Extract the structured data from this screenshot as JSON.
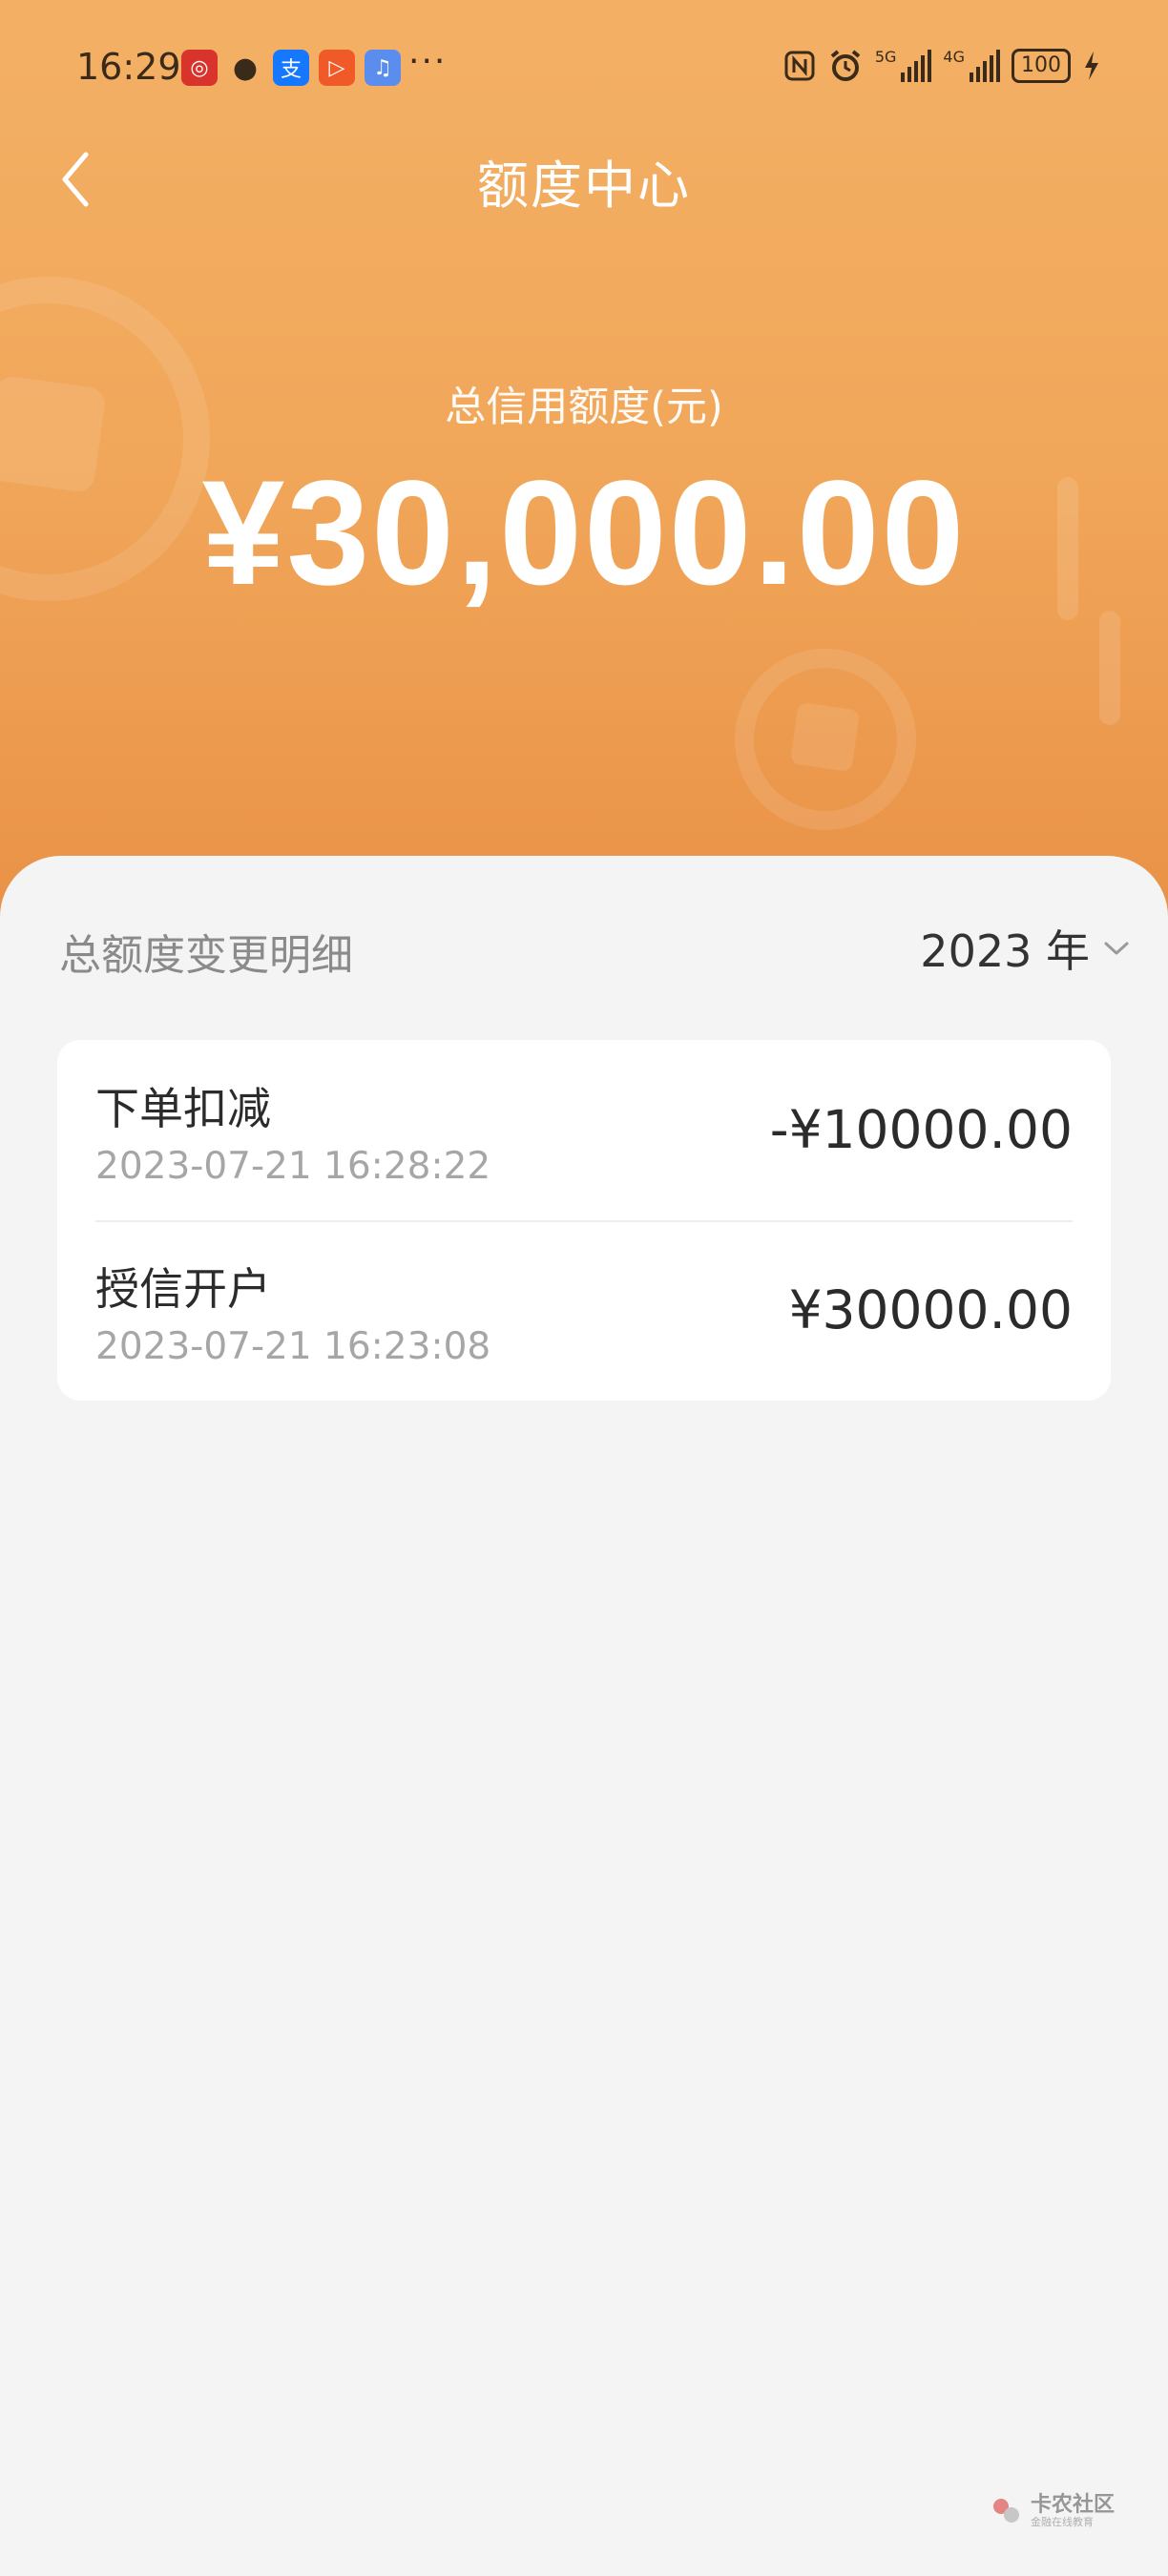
{
  "status_bar": {
    "time": "16:29",
    "apps": [
      {
        "icon": "bank-app-icon",
        "color": "#d9342b",
        "glyph": "◎"
      },
      {
        "icon": "wechat-icon",
        "color": "#3a2a1a",
        "glyph": "●"
      },
      {
        "icon": "alipay-icon",
        "color": "#1677ff",
        "glyph": "支"
      },
      {
        "icon": "video-app-icon",
        "color": "#f05a28",
        "glyph": "▷"
      },
      {
        "icon": "music-app-icon",
        "color": "#5b8def",
        "glyph": "♫"
      }
    ],
    "more": "···",
    "net_5g": "5G",
    "net_4g": "4G",
    "battery": "100"
  },
  "nav": {
    "title": "额度中心"
  },
  "credit": {
    "label": "总信用额度(元)",
    "amount": "¥30,000.00"
  },
  "details": {
    "section_title": "总额度变更明细",
    "year": "2023 年",
    "items": [
      {
        "title": "下单扣减",
        "date": "2023-07-21 16:28:22",
        "amount": "-¥10000.00"
      },
      {
        "title": "授信开户",
        "date": "2023-07-21 16:23:08",
        "amount": "¥30000.00"
      }
    ]
  },
  "watermark": {
    "main": "卡农社区",
    "sub": "金融在线教育"
  },
  "colors": {
    "header_top": "#f3b065",
    "header_bottom": "#e99247",
    "background": "#f4f4f4",
    "card": "#ffffff",
    "muted_text": "#a6a6a6"
  }
}
